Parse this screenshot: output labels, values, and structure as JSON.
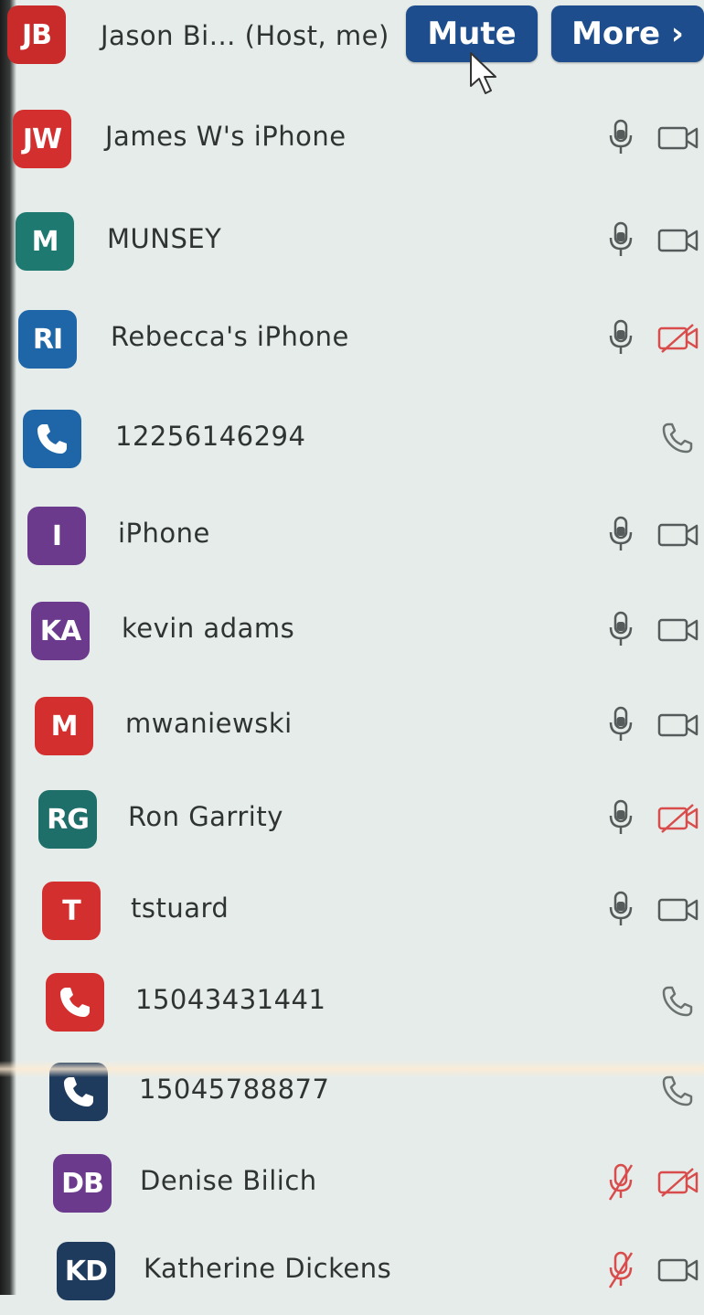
{
  "host": {
    "initials": "JB",
    "name": "Jason Bi... (Host, me)",
    "color": "#c92a2a",
    "mute_label": "Mute",
    "more_label": "More ›"
  },
  "participants": [
    {
      "initials": "JW",
      "name": "James W's iPhone",
      "color": "#d32f2f",
      "mic": "on",
      "video": "on"
    },
    {
      "initials": "M",
      "name": "MUNSEY",
      "color": "#1e7a70",
      "mic": "on",
      "video": "on"
    },
    {
      "initials": "RI",
      "name": "Rebecca's iPhone",
      "color": "#1f66a8",
      "mic": "on",
      "video": "off"
    },
    {
      "initials": "",
      "name": "12256146294",
      "color": "#1f66a8",
      "type": "phone"
    },
    {
      "initials": "I",
      "name": "iPhone",
      "color": "#6b3a8c",
      "mic": "on",
      "video": "on"
    },
    {
      "initials": "KA",
      "name": "kevin adams",
      "color": "#6b3a8c",
      "mic": "on",
      "video": "on"
    },
    {
      "initials": "M",
      "name": "mwaniewski",
      "color": "#d32f2f",
      "mic": "on",
      "video": "on"
    },
    {
      "initials": "RG",
      "name": "Ron Garrity",
      "color": "#1e6e6a",
      "mic": "on",
      "video": "off"
    },
    {
      "initials": "T",
      "name": "tstuard",
      "color": "#d32f2f",
      "mic": "on",
      "video": "on"
    },
    {
      "initials": "",
      "name": "15043431441",
      "color": "#d32f2f",
      "type": "phone"
    },
    {
      "initials": "",
      "name": "15045788877",
      "color": "#1e3a5c",
      "type": "phone"
    },
    {
      "initials": "DB",
      "name": "Denise Bilich",
      "color": "#6b3a8c",
      "mic": "off",
      "video": "off"
    },
    {
      "initials": "KD",
      "name": "Katherine Dickens",
      "color": "#1e3a5c",
      "mic": "off",
      "video": "on"
    }
  ]
}
